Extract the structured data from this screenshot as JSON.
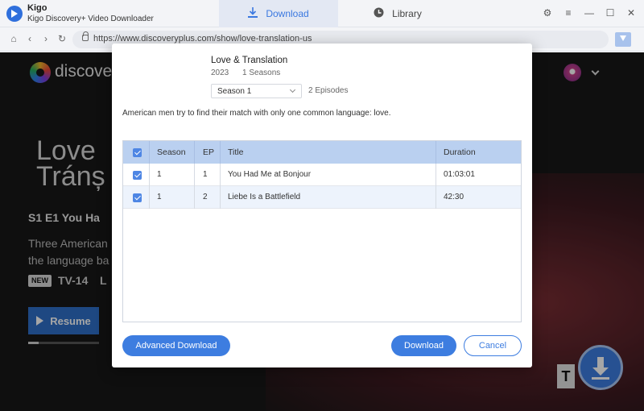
{
  "app": {
    "name": "Kigo",
    "subtitle": "Kigo Discovery+ Video Downloader",
    "accent_color": "#3d7de0"
  },
  "tabs": [
    {
      "label": "Download",
      "icon": "download-icon",
      "active": true
    },
    {
      "label": "Library",
      "icon": "clock-icon",
      "active": false
    }
  ],
  "window_controls": [
    "settings-icon",
    "menu-icon",
    "minimize-icon",
    "maximize-icon",
    "close-icon"
  ],
  "address_bar": {
    "url": "https://www.discoveryplus.com/show/love-translation-us"
  },
  "background_page": {
    "logo_text": "discover",
    "title_line1": "Love",
    "title_line2": "Tránș",
    "episode": "S1 E1  You Ha",
    "desc_line1": "Three American",
    "desc_line2": "the language ba",
    "badge": "NEW",
    "rating": "TV-14",
    "rating_extra": "L",
    "resume_label": "Resume",
    "progress": 0.15,
    "fab_t": "T"
  },
  "modal": {
    "title": "Love & Translation",
    "year": "2023",
    "seasons": "1 Seasons",
    "season_selected": "Season 1",
    "episodes_count": "2 Episodes",
    "description": "American men try to find their match with only one common language: love.",
    "columns": [
      "Season",
      "EP",
      "Title",
      "Duration"
    ],
    "rows": [
      {
        "season": "1",
        "ep": "1",
        "title": "You Had Me at Bonjour",
        "duration": "01:03:01",
        "checked": true
      },
      {
        "season": "1",
        "ep": "2",
        "title": "Liebe Is a Battlefield",
        "duration": "42:30",
        "checked": true
      }
    ],
    "buttons": {
      "advanced": "Advanced Download",
      "download": "Download",
      "cancel": "Cancel"
    }
  }
}
